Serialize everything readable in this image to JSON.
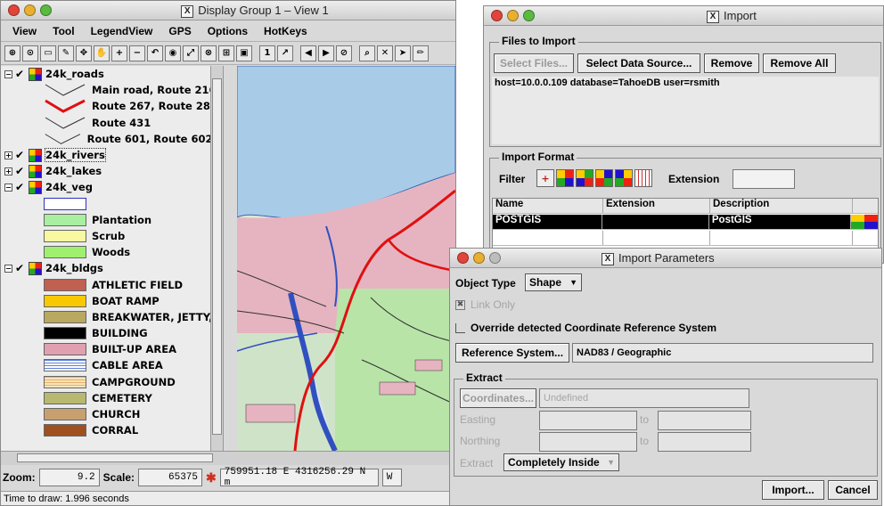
{
  "main_window": {
    "title": "Display Group 1 – View 1",
    "menu": [
      "View",
      "Tool",
      "LegendView",
      "GPS",
      "Options",
      "HotKeys"
    ],
    "toolbar_icons": [
      "zoom-region-icon",
      "zoom-fit-icon",
      "window-icon",
      "sketch-icon",
      "move-icon",
      "pan-icon",
      "zoom-in-icon",
      "zoom-out-icon",
      "zoom-prev-icon",
      "zoom-layer-icon",
      "zoom-full-icon",
      "zoom-scale-icon",
      "fit-view-icon",
      "screenshot-icon",
      "one-to-one-icon",
      "north-arrow-icon",
      "back-icon",
      "forward-icon",
      "stop-icon",
      "search-icon",
      "delete-icon",
      "select-icon",
      "pencil-icon"
    ],
    "legend": [
      {
        "kind": "layer",
        "label": "24k_roads",
        "expander": "⊟",
        "checked": true
      },
      {
        "kind": "line",
        "label": "Main road, Route 216",
        "color": "#303030",
        "width": 1
      },
      {
        "kind": "line",
        "label": "Route 267, Route 28…",
        "color": "#e01010",
        "width": 3
      },
      {
        "kind": "line",
        "label": "Route 431",
        "color": "#303030",
        "width": 1
      },
      {
        "kind": "line",
        "label": "Route 601, Route 602…",
        "color": "#303030",
        "width": 1
      },
      {
        "kind": "layer",
        "label": "24k_rivers",
        "expander": "⊞",
        "checked": true
      },
      {
        "kind": "layer",
        "label": "24k_lakes",
        "expander": "⊞",
        "checked": true
      },
      {
        "kind": "layer",
        "label": "24k_veg",
        "expander": "⊟",
        "checked": true
      },
      {
        "kind": "swatch",
        "label": "",
        "color": "#ffffff",
        "border": "#3030c0"
      },
      {
        "kind": "swatch",
        "label": "Plantation",
        "color": "#a8f0a0"
      },
      {
        "kind": "swatch",
        "label": "Scrub",
        "color": "#f8f8a0"
      },
      {
        "kind": "swatch",
        "label": "Woods",
        "color": "#a0f070"
      },
      {
        "kind": "layer",
        "label": "24k_bldgs",
        "expander": "⊟",
        "checked": true
      },
      {
        "kind": "swatch",
        "label": "ATHLETIC FIELD",
        "color": "#c06050"
      },
      {
        "kind": "swatch",
        "label": "BOAT RAMP",
        "color": "#f8c800"
      },
      {
        "kind": "swatch",
        "label": "BREAKWATER, JETTY, I",
        "color": "#b8a860"
      },
      {
        "kind": "swatch",
        "label": "BUILDING",
        "color": "#000000"
      },
      {
        "kind": "swatch",
        "label": "BUILT-UP AREA",
        "color": "#e0a0b0"
      },
      {
        "kind": "swatch",
        "label": "CABLE AREA",
        "color": "#b8c8f8"
      },
      {
        "kind": "swatch",
        "label": "CAMPGROUND",
        "color": "#f0c890"
      },
      {
        "kind": "swatch",
        "label": "CEMETERY",
        "color": "#b8b870"
      },
      {
        "kind": "swatch",
        "label": "CHURCH",
        "color": "#c8a070"
      },
      {
        "kind": "swatch",
        "label": "CORRAL",
        "color": "#a05020"
      }
    ],
    "status": {
      "zoom_label": "Zoom:",
      "zoom_value": "9.2",
      "scale_label": "Scale:",
      "scale_value": "65375",
      "coords": "759951.18 E  4316256.29 N m",
      "extra": "W"
    },
    "time_to_draw": "Time to draw: 1.996 seconds"
  },
  "import_window": {
    "title": "Import",
    "files_group": "Files to Import",
    "buttons": {
      "select_files": "Select Files...",
      "select_source": "Select Data Source...",
      "remove": "Remove",
      "remove_all": "Remove All"
    },
    "source_text": "host=10.0.0.109  database=TahoeDB  user=rsmith",
    "format_group": "Import Format",
    "filter_label": "Filter",
    "extension_label": "Extension",
    "extension_value": "",
    "table_headers": [
      "Name",
      "Extension",
      "Description"
    ],
    "table_rows": [
      {
        "name": "POSTGIS",
        "extension": "",
        "description": "PostGIS",
        "selected": true
      }
    ]
  },
  "params_window": {
    "title": "Import Parameters",
    "object_type_label": "Object Type",
    "object_type_value": "Shape",
    "link_only_label": "Link Only",
    "override_label": "Override detected Coordinate Reference System",
    "ref_system_button": "Reference System...",
    "ref_system_value": "NAD83 / Geographic",
    "extract_group": "Extract",
    "coordinates_button": "Coordinates...",
    "coordinates_value": "Undefined",
    "easting_label": "Easting",
    "northing_label": "Northing",
    "to_label": "to",
    "extract_label": "Extract",
    "extract_value": "Completely Inside",
    "import_button": "Import...",
    "cancel_button": "Cancel"
  }
}
